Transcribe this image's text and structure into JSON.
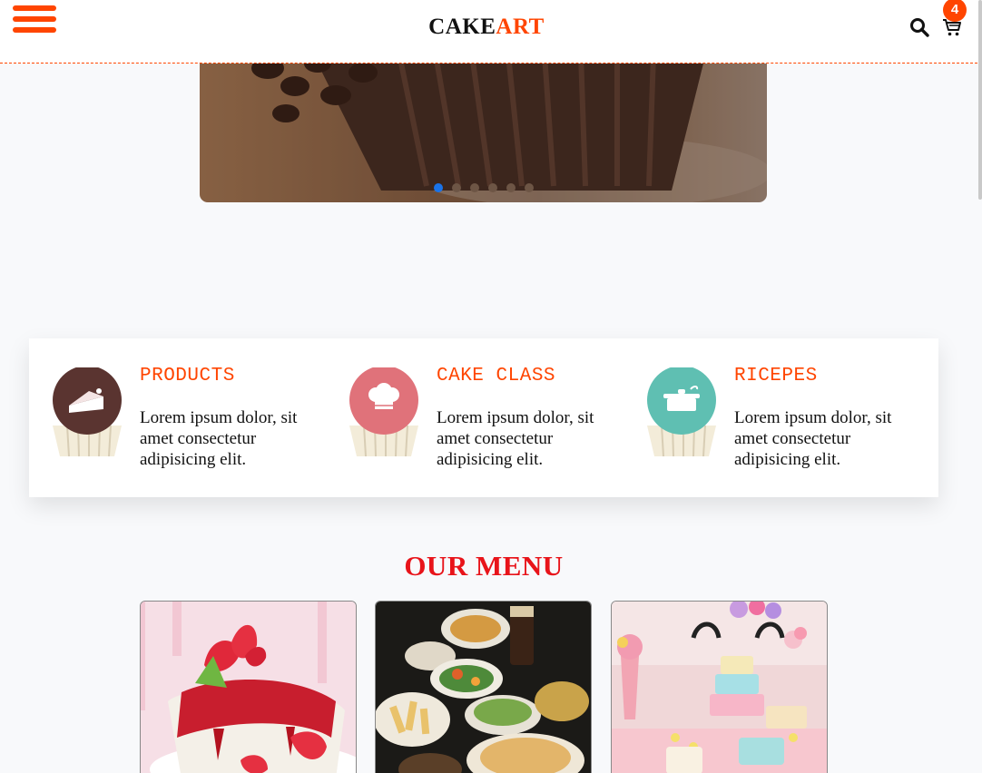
{
  "header": {
    "logo_part1": "CAKE",
    "logo_part2": "ART",
    "cart_count": "4",
    "icons": {
      "menu": "hamburger-menu-icon",
      "search": "search-icon",
      "cart": "cart-icon"
    }
  },
  "hero": {
    "image": "chocolate cupcake close-up",
    "slide_count": 6,
    "active_slide": 1
  },
  "features": [
    {
      "title": "PRODUCTS",
      "text": "Lorem ipsum dolor, sit amet consectetur adipisicing elit.",
      "icon": "cake-slice-cupcake-icon",
      "frosting_color": "#5a3430"
    },
    {
      "title": "CAKE CLASS",
      "text": "Lorem ipsum dolor, sit amet consectetur adipisicing elit.",
      "icon": "chef-hat-cupcake-icon",
      "frosting_color": "#e0727a"
    },
    {
      "title": "RICEPES",
      "text": "Lorem ipsum dolor, sit amet consectetur adipisicing elit.",
      "icon": "cooking-pot-cupcake-icon",
      "frosting_color": "#5fbfb2"
    }
  ],
  "menu": {
    "title": "OUR MENU",
    "items": [
      {
        "image": "panna cotta with strawberries"
      },
      {
        "image": "table of savory dishes"
      },
      {
        "image": "pastel unicorn party dessert table"
      }
    ]
  },
  "colors": {
    "accent": "#ff4500",
    "menu_title": "#e8141a",
    "active_dot": "#1a73e8"
  }
}
